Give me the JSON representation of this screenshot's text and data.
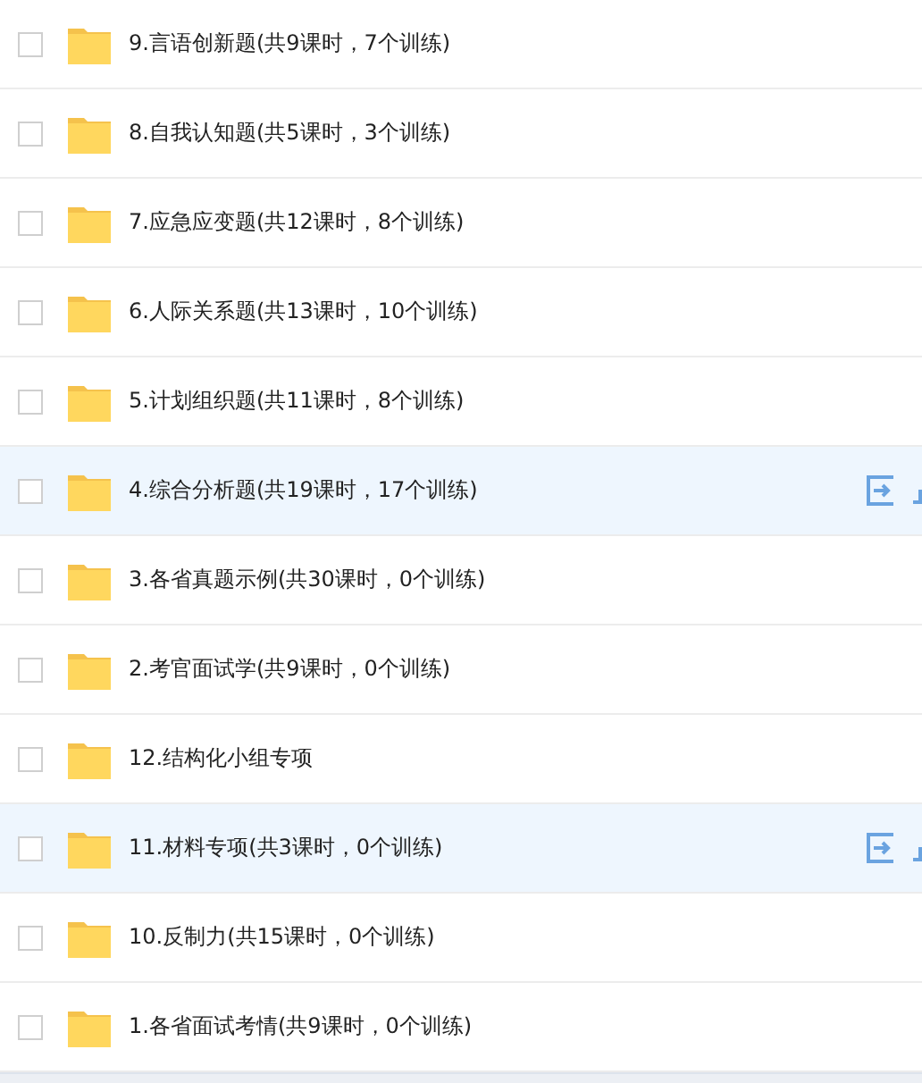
{
  "rows": [
    {
      "title": "9.言语创新题(共9课时，7个训练)",
      "checked": false,
      "highlighted": false
    },
    {
      "title": "8.自我认知题(共5课时，3个训练)",
      "checked": false,
      "highlighted": false
    },
    {
      "title": "7.应急应变题(共12课时，8个训练)",
      "checked": false,
      "highlighted": false
    },
    {
      "title": "6.人际关系题(共13课时，10个训练)",
      "checked": false,
      "highlighted": false
    },
    {
      "title": "5.计划组织题(共11课时，8个训练)",
      "checked": false,
      "highlighted": false
    },
    {
      "title": "4.综合分析题(共19课时，17个训练)",
      "checked": false,
      "highlighted": true
    },
    {
      "title": "3.各省真题示例(共30课时，0个训练)",
      "checked": false,
      "highlighted": false
    },
    {
      "title": "2.考官面试学(共9课时，0个训练)",
      "checked": false,
      "highlighted": false
    },
    {
      "title": "12.结构化小组专项",
      "checked": false,
      "highlighted": false
    },
    {
      "title": "11.材料专项(共3课时，0个训练)",
      "checked": false,
      "highlighted": true
    },
    {
      "title": "10.反制力(共15课时，0个训练)",
      "checked": false,
      "highlighted": false
    },
    {
      "title": "1.各省面试考情(共9课时，0个训练)",
      "checked": false,
      "highlighted": false
    }
  ]
}
